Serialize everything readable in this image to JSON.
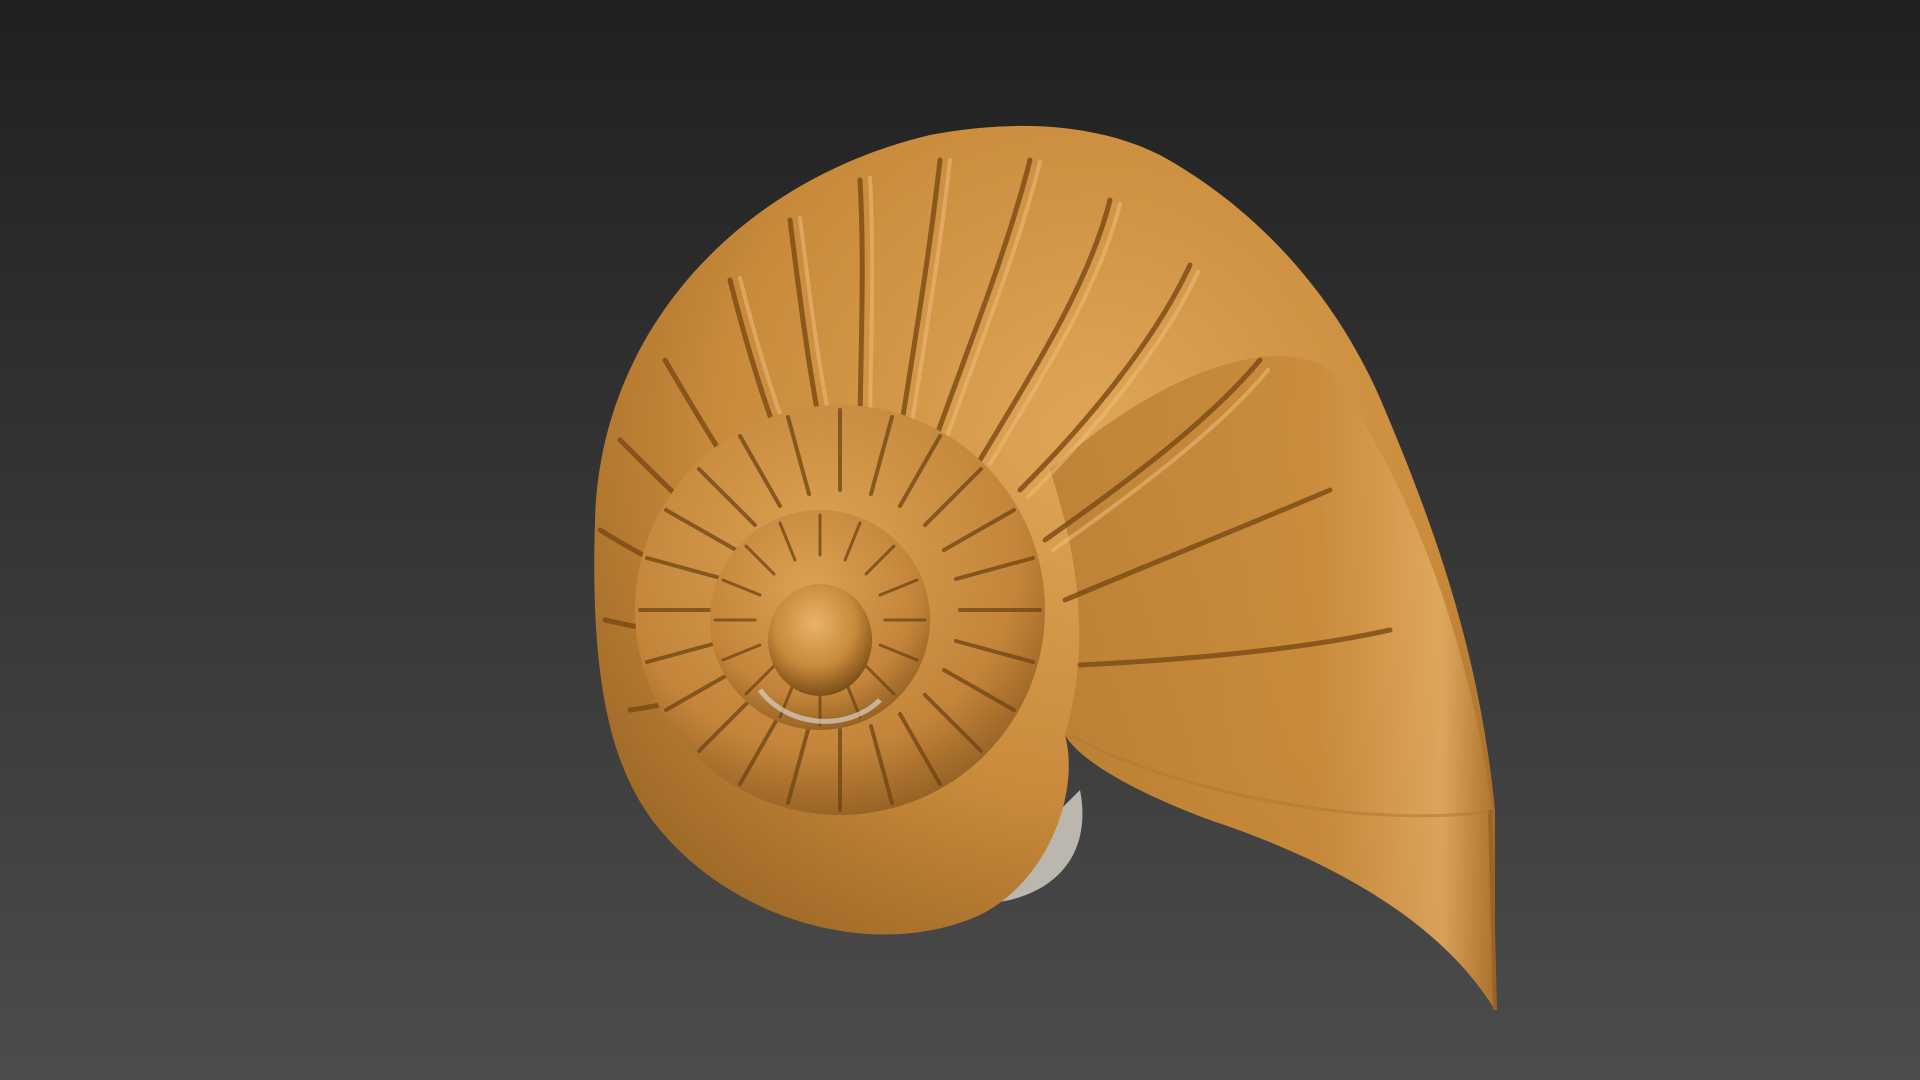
{
  "viewport": {
    "background_top": "#202020",
    "background_bottom": "#4c4c4c"
  },
  "model": {
    "object": "nautilus-shell",
    "base_color": "#c98a3b",
    "highlight_color": "#e2a85a",
    "shadow_color": "#8a5a1c",
    "groove_color": "#6e4413",
    "underside_color": "#c9c4bb"
  }
}
